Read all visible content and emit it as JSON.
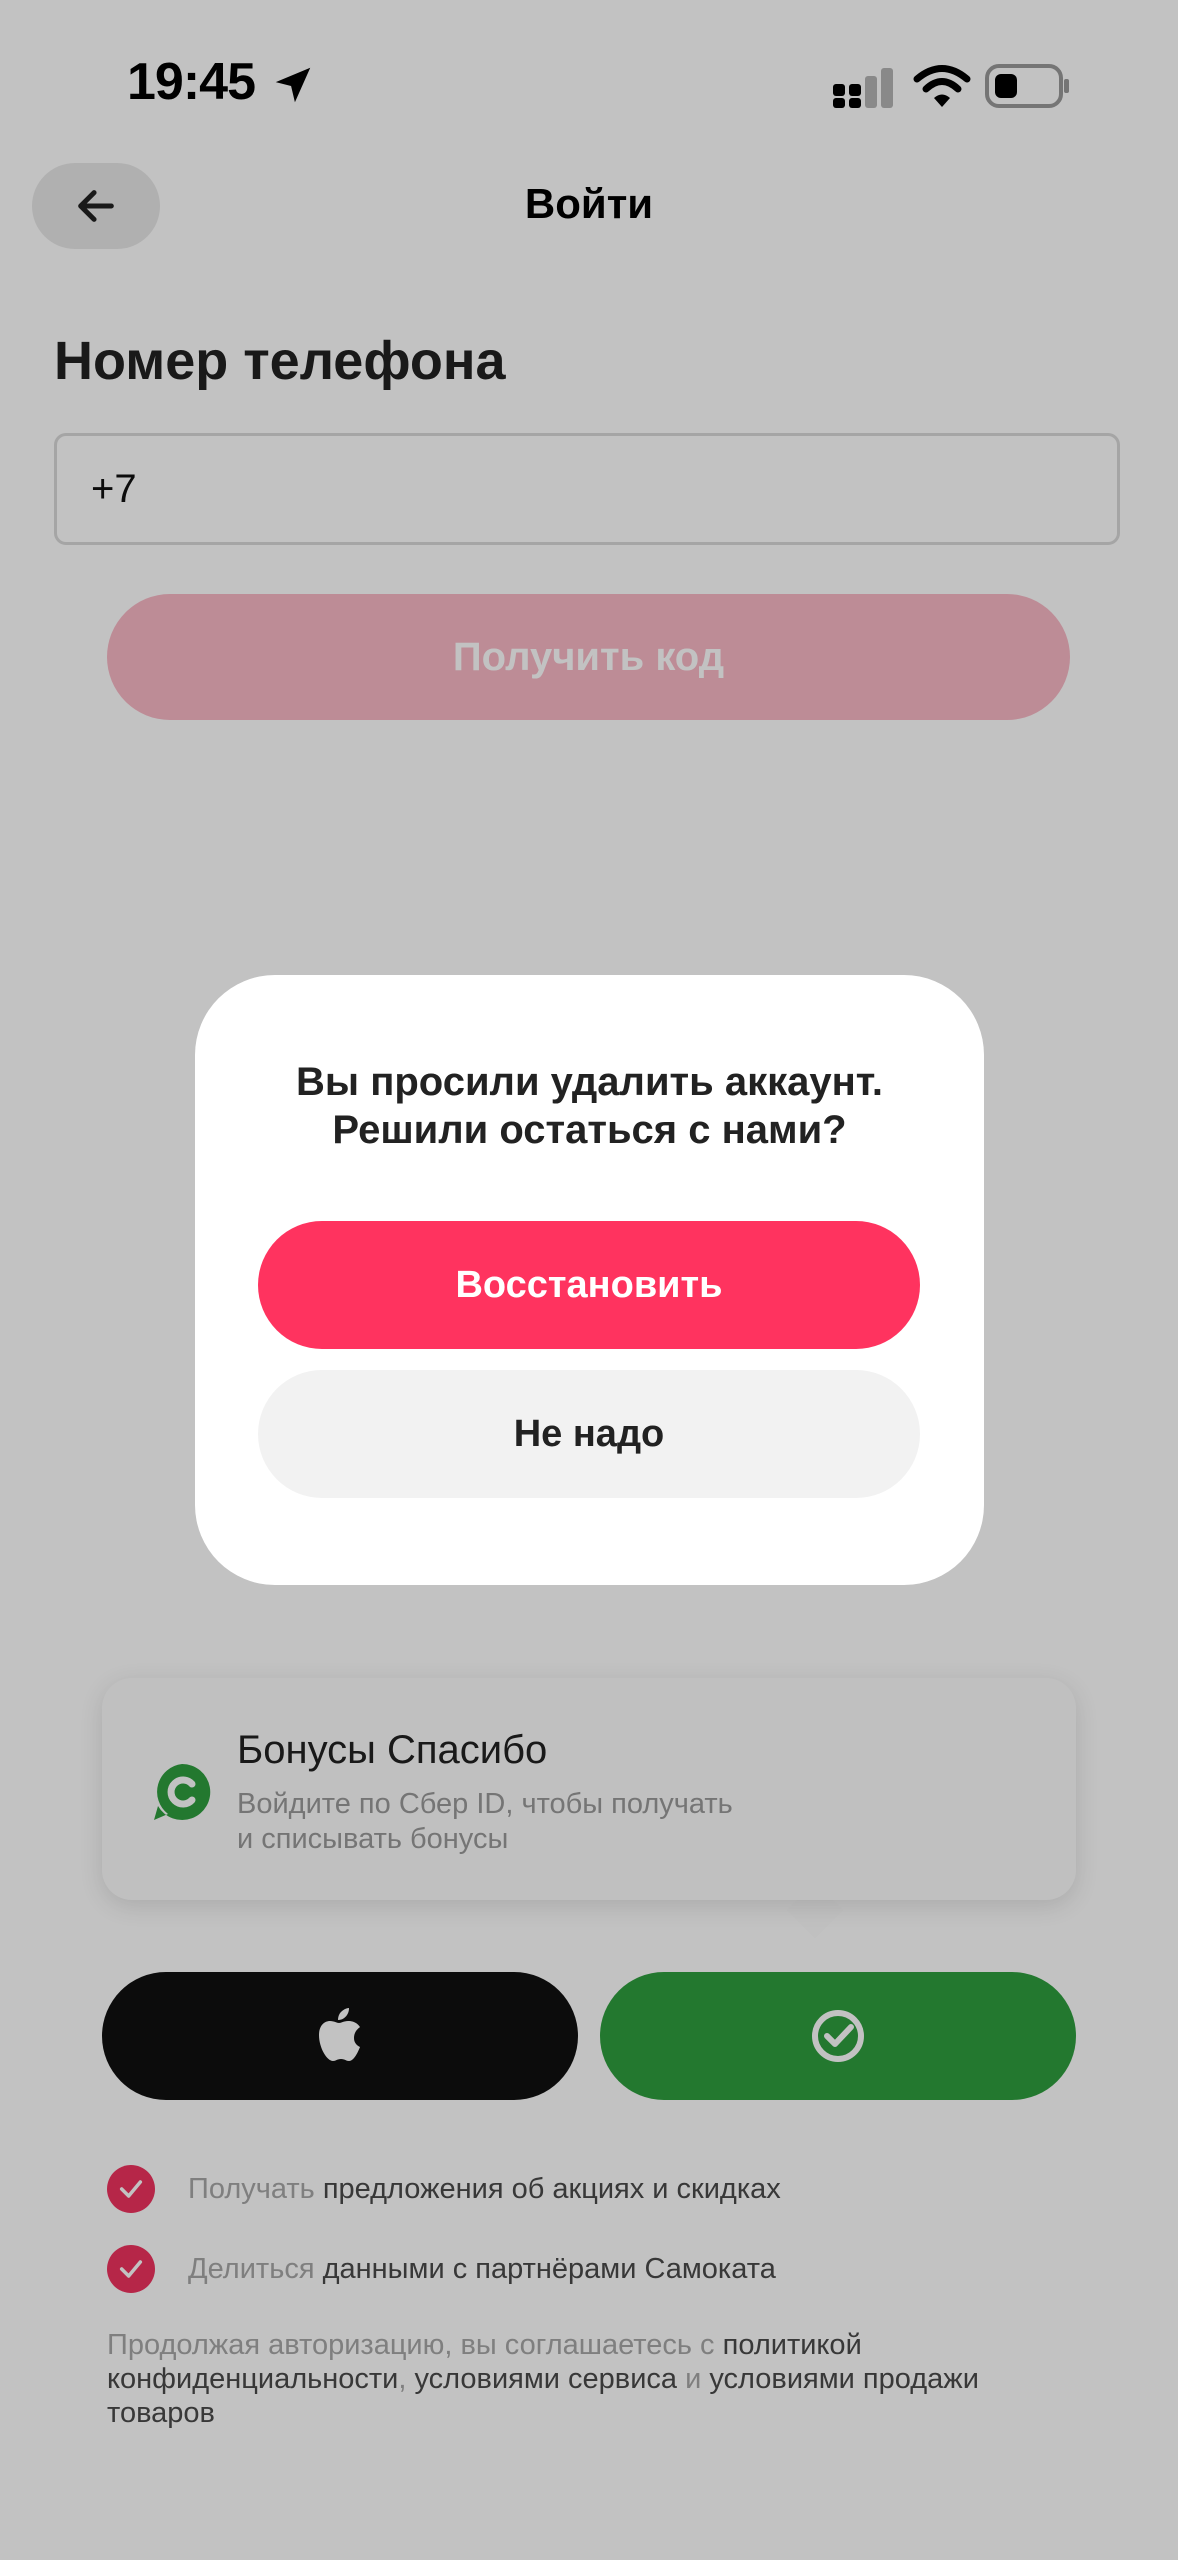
{
  "status_bar": {
    "time": "19:45"
  },
  "header": {
    "title": "Войти",
    "back_icon": "arrow-left-icon"
  },
  "phone": {
    "label": "Номер телефона",
    "value": "+7"
  },
  "get_code_button": "Получить код",
  "bonus": {
    "title": "Бонусы Спасибо",
    "subtitle_line1": "Войдите по Сбер ID, чтобы получать",
    "subtitle_line2": "и списывать бонусы",
    "logo_icon": "sber-spasibo-icon"
  },
  "auth_buttons": {
    "apple_icon": "apple-icon",
    "sber_icon": "sber-id-icon"
  },
  "options": [
    {
      "prefix": "Получать",
      "text": "предложения об акциях и скидках",
      "checked": true
    },
    {
      "prefix": "Делиться",
      "text": "данными с партнёрами Самоката",
      "checked": true
    }
  ],
  "legal": {
    "intro": "Продолжая авторизацию, вы соглашаетесь с",
    "policy": "политикой конфиденциальности",
    "sep1": ",",
    "terms": "условиями сервиса",
    "and": "и",
    "sales": "условиями продажи товаров"
  },
  "dialog": {
    "message_line1": "Вы просили удалить аккаунт.",
    "message_line2": "Решили остаться с нами?",
    "restore_label": "Восстановить",
    "decline_label": "Не надо"
  },
  "colors": {
    "accent": "#ff335f",
    "accent_disabled": "#f9b8c6",
    "sber_green": "#2f9e3f",
    "overlay": "rgba(0,0,0,0.24)"
  }
}
